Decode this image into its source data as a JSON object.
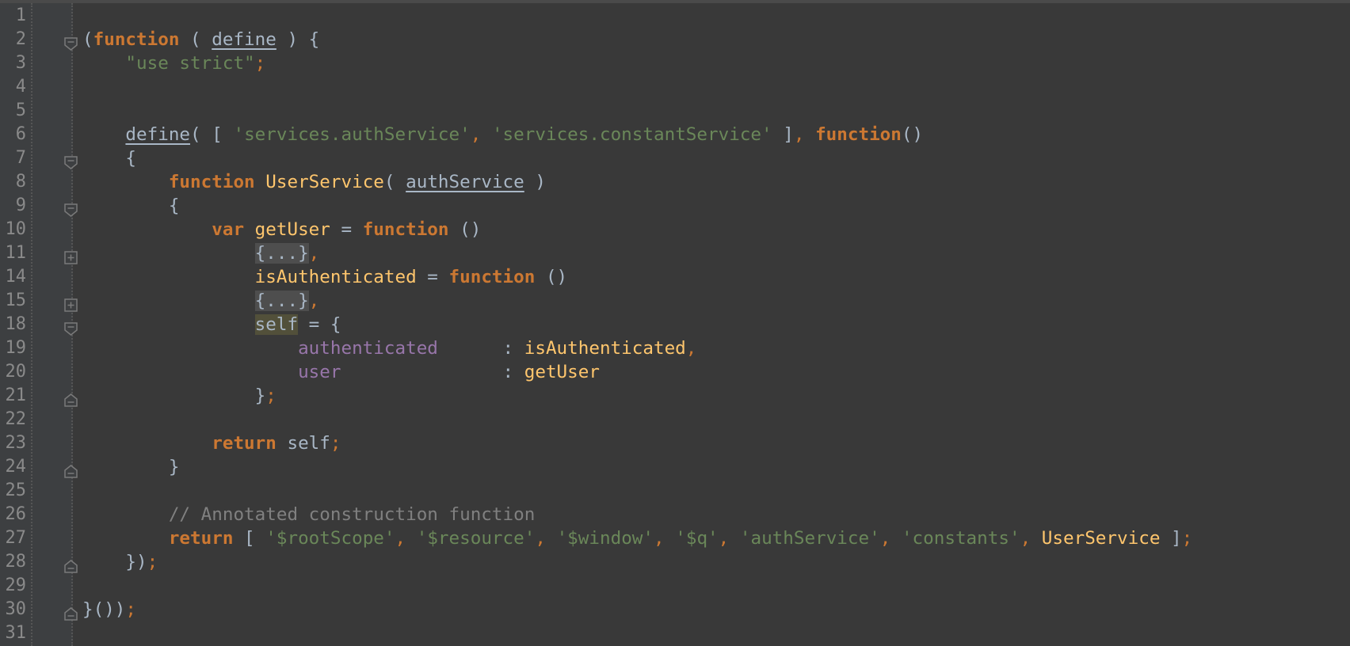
{
  "editor": {
    "language": "javascript",
    "colors": {
      "background": "#393939",
      "gutter": "#3d3f41",
      "keyword": "#cc7832",
      "string": "#6a8759",
      "function_name": "#ffc66d",
      "property": "#9876aa",
      "comment": "#808080",
      "default": "#a9b7c6"
    },
    "lines": [
      {
        "n": "1",
        "fold": null,
        "tokens": []
      },
      {
        "n": "2",
        "fold": "collapse-start",
        "tokens": [
          [
            "p",
            "("
          ],
          [
            "kw",
            "function"
          ],
          [
            "p",
            " ( "
          ],
          [
            "ul",
            "define"
          ],
          [
            "p",
            " ) {"
          ]
        ]
      },
      {
        "n": "3",
        "fold": null,
        "tokens": [
          [
            "p",
            "    "
          ],
          [
            "str",
            "\"use strict\""
          ],
          [
            "punc",
            ";"
          ]
        ]
      },
      {
        "n": "4",
        "fold": null,
        "tokens": []
      },
      {
        "n": "5",
        "fold": null,
        "tokens": []
      },
      {
        "n": "6",
        "fold": null,
        "tokens": [
          [
            "p",
            "    "
          ],
          [
            "ul",
            "define"
          ],
          [
            "p",
            "( [ "
          ],
          [
            "str",
            "'services.authService'"
          ],
          [
            "punc",
            ","
          ],
          [
            "p",
            " "
          ],
          [
            "str",
            "'services.constantService'"
          ],
          [
            "p",
            " ]"
          ],
          [
            "punc",
            ","
          ],
          [
            "p",
            " "
          ],
          [
            "kw",
            "function"
          ],
          [
            "p",
            "()"
          ]
        ]
      },
      {
        "n": "7",
        "fold": "collapse-start",
        "tokens": [
          [
            "p",
            "    {"
          ]
        ]
      },
      {
        "n": "8",
        "fold": null,
        "tokens": [
          [
            "p",
            "        "
          ],
          [
            "kw",
            "function"
          ],
          [
            "p",
            " "
          ],
          [
            "fn",
            "UserService"
          ],
          [
            "p",
            "( "
          ],
          [
            "ul",
            "authService"
          ],
          [
            "p",
            " )"
          ]
        ]
      },
      {
        "n": "9",
        "fold": "collapse-start",
        "tokens": [
          [
            "p",
            "        {"
          ]
        ]
      },
      {
        "n": "10",
        "fold": null,
        "tokens": [
          [
            "p",
            "            "
          ],
          [
            "kw",
            "var"
          ],
          [
            "p",
            " "
          ],
          [
            "fn",
            "getUser"
          ],
          [
            "p",
            " = "
          ],
          [
            "kw",
            "function"
          ],
          [
            "p",
            " ()"
          ]
        ]
      },
      {
        "n": "11",
        "fold": "expand",
        "tokens": [
          [
            "p",
            "                "
          ],
          [
            "folded",
            "{...}"
          ],
          [
            "punc",
            ","
          ]
        ]
      },
      {
        "n": "14",
        "fold": null,
        "tokens": [
          [
            "p",
            "                "
          ],
          [
            "fn",
            "isAuthenticated"
          ],
          [
            "p",
            " = "
          ],
          [
            "kw",
            "function"
          ],
          [
            "p",
            " ()"
          ]
        ]
      },
      {
        "n": "15",
        "fold": "expand",
        "tokens": [
          [
            "p",
            "                "
          ],
          [
            "folded",
            "{...}"
          ],
          [
            "punc",
            ","
          ]
        ]
      },
      {
        "n": "18",
        "fold": "collapse-start",
        "tokens": [
          [
            "p",
            "                "
          ],
          [
            "hl",
            "self"
          ],
          [
            "p",
            " = {"
          ]
        ]
      },
      {
        "n": "19",
        "fold": null,
        "tokens": [
          [
            "p",
            "                    "
          ],
          [
            "prop",
            "authenticated"
          ],
          [
            "p",
            "      : "
          ],
          [
            "fn",
            "isAuthenticated"
          ],
          [
            "punc",
            ","
          ]
        ]
      },
      {
        "n": "20",
        "fold": null,
        "tokens": [
          [
            "p",
            "                    "
          ],
          [
            "prop",
            "user"
          ],
          [
            "p",
            "               : "
          ],
          [
            "fn",
            "getUser"
          ]
        ]
      },
      {
        "n": "21",
        "fold": "collapse-end",
        "tokens": [
          [
            "p",
            "                }"
          ],
          [
            "punc",
            ";"
          ]
        ]
      },
      {
        "n": "22",
        "fold": null,
        "tokens": []
      },
      {
        "n": "23",
        "fold": null,
        "tokens": [
          [
            "p",
            "            "
          ],
          [
            "kw",
            "return"
          ],
          [
            "p",
            " self"
          ],
          [
            "punc",
            ";"
          ]
        ]
      },
      {
        "n": "24",
        "fold": "collapse-end",
        "tokens": [
          [
            "p",
            "        }"
          ]
        ]
      },
      {
        "n": "25",
        "fold": null,
        "tokens": []
      },
      {
        "n": "26",
        "fold": null,
        "tokens": [
          [
            "p",
            "        "
          ],
          [
            "cmt",
            "// Annotated construction function"
          ]
        ]
      },
      {
        "n": "27",
        "fold": null,
        "tokens": [
          [
            "p",
            "        "
          ],
          [
            "kw",
            "return"
          ],
          [
            "p",
            " [ "
          ],
          [
            "str",
            "'$rootScope'"
          ],
          [
            "punc",
            ","
          ],
          [
            "p",
            " "
          ],
          [
            "str",
            "'$resource'"
          ],
          [
            "punc",
            ","
          ],
          [
            "p",
            " "
          ],
          [
            "str",
            "'$window'"
          ],
          [
            "punc",
            ","
          ],
          [
            "p",
            " "
          ],
          [
            "str",
            "'$q'"
          ],
          [
            "punc",
            ","
          ],
          [
            "p",
            " "
          ],
          [
            "str",
            "'authService'"
          ],
          [
            "punc",
            ","
          ],
          [
            "p",
            " "
          ],
          [
            "str",
            "'constants'"
          ],
          [
            "punc",
            ","
          ],
          [
            "p",
            " "
          ],
          [
            "fn",
            "UserService"
          ],
          [
            "p",
            " ]"
          ],
          [
            "punc",
            ";"
          ]
        ]
      },
      {
        "n": "28",
        "fold": "collapse-end",
        "tokens": [
          [
            "p",
            "    })"
          ],
          [
            "punc",
            ";"
          ]
        ]
      },
      {
        "n": "29",
        "fold": null,
        "tokens": []
      },
      {
        "n": "30",
        "fold": "collapse-end",
        "tokens": [
          [
            "p",
            "}())"
          ],
          [
            "punc",
            ";"
          ]
        ]
      },
      {
        "n": "31",
        "fold": null,
        "tokens": []
      }
    ]
  }
}
